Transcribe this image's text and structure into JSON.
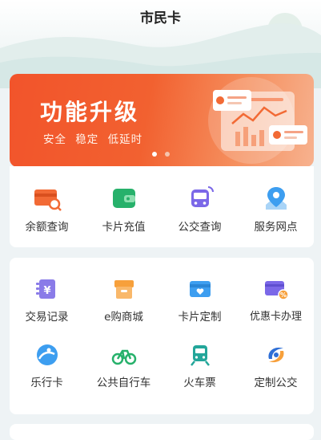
{
  "app": {
    "title": "市民卡"
  },
  "banner": {
    "title": "功能升级",
    "subtitle": "安全  稳定  低延时",
    "page_count": 2,
    "active_page": 1,
    "colors": {
      "start": "#f2542b",
      "end": "#f7b28f"
    }
  },
  "quick_actions": [
    {
      "label": "余额查询",
      "icon": "card-search-icon"
    },
    {
      "label": "卡片充值",
      "icon": "wallet-icon"
    },
    {
      "label": "公交查询",
      "icon": "bus-icon"
    },
    {
      "label": "服务网点",
      "icon": "map-pin-icon"
    }
  ],
  "services": [
    {
      "label": "交易记录",
      "icon": "yen-receipt-icon"
    },
    {
      "label": "e购商城",
      "icon": "shop-icon"
    },
    {
      "label": "卡片定制",
      "icon": "card-heart-icon"
    },
    {
      "label": "优惠卡办理",
      "icon": "discount-card-icon"
    },
    {
      "label": "乐行卡",
      "icon": "travel-card-icon"
    },
    {
      "label": "公共自行车",
      "icon": "bicycle-icon"
    },
    {
      "label": "火车票",
      "icon": "train-icon"
    },
    {
      "label": "定制公交",
      "icon": "custom-bus-logo-icon"
    }
  ],
  "accent_colors": {
    "orange": "#f26a35",
    "green": "#27b16b",
    "purple": "#7b68e8",
    "blue": "#3d9ef0"
  }
}
